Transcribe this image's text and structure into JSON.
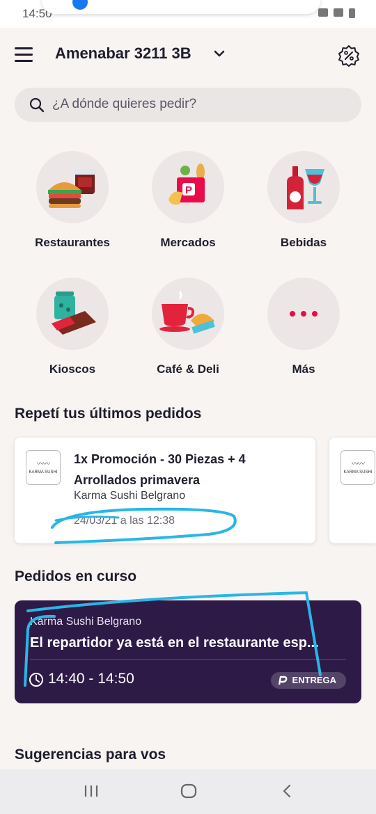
{
  "status_bar": {
    "time": "14:50"
  },
  "header": {
    "address": "Amenabar 3211 3B"
  },
  "search": {
    "placeholder": "¿A dónde quieres pedir?"
  },
  "categories": [
    {
      "label": "Restaurantes",
      "icon": "burger-icon"
    },
    {
      "label": "Mercados",
      "icon": "grocery-bag-icon"
    },
    {
      "label": "Bebidas",
      "icon": "drinks-icon"
    },
    {
      "label": "Kioscos",
      "icon": "candy-icon"
    },
    {
      "label": "Café & Deli",
      "icon": "coffee-icon"
    },
    {
      "label": "Más",
      "icon": "more-dots-icon"
    }
  ],
  "repeat_section": {
    "title": "Repetí tus últimos pedidos",
    "orders": [
      {
        "title": "1x Promoción - 30 Piezas + 4 Arrollados primavera",
        "store": "Karma Sushi Belgrano",
        "date": "24/03/21 a las 12:38",
        "logo_text": "KARMA SUSHI"
      },
      {
        "logo_text": "KARMA SUSHI"
      }
    ]
  },
  "active_section": {
    "title": "Pedidos en curso",
    "store": "Karma Sushi Belgrano",
    "status": "El repartidor ya está en el restaurante esp...",
    "time": "14:40 - 14:50",
    "badge": "ENTREGA"
  },
  "suggestions": {
    "title": "Sugerencias para vos"
  },
  "colors": {
    "background": "#f8f4f2",
    "active_card": "#2e1a47",
    "accent_red": "#ea0b4a",
    "scribble": "#29b6e6"
  }
}
